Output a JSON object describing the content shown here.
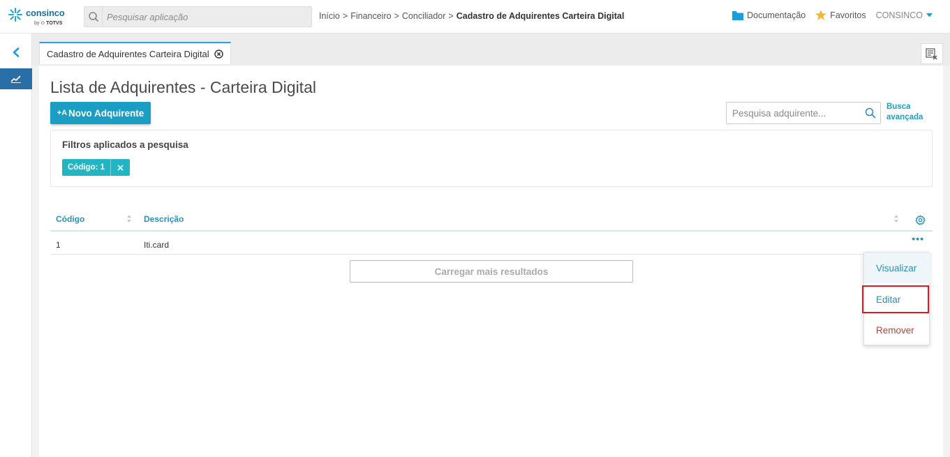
{
  "header": {
    "brand": "consinco",
    "brand_by": "by",
    "brand_company": "TOTVS",
    "search_placeholder": "Pesquisar aplicação",
    "breadcrumb": [
      "Início",
      "Financeiro",
      "Conciliador",
      "Cadastro de Adquirentes Carteira Digital"
    ],
    "breadcrumb_separator": ">",
    "documentation": "Documentação",
    "favorites": "Favoritos",
    "user": "CONSINCO"
  },
  "tabs": [
    {
      "label": "Cadastro de Adquirentes Carteira Digital",
      "active": true
    }
  ],
  "page": {
    "title": "Lista de Adquirentes - Carteira Digital",
    "new_button_prefix": "+A",
    "new_button": "Novo Adquirente",
    "search_placeholder": "Pesquisa adquirente...",
    "advanced_search_line1": "Busca",
    "advanced_search_line2": "avançada"
  },
  "filters": {
    "title": "Filtros aplicados a pesquisa",
    "chips": [
      {
        "label": "Código: 1"
      }
    ]
  },
  "table": {
    "columns": [
      "Código",
      "Descrição"
    ],
    "rows": [
      {
        "codigo": "1",
        "descricao": "Iti.card"
      }
    ],
    "row_menu_icon": "ellipsis-icon"
  },
  "load_more": "Carregar mais resultados",
  "row_menu": {
    "items": [
      "Visualizar",
      "Editar",
      "Remover"
    ],
    "highlighted": "Editar"
  },
  "colors": {
    "primary": "#1a9ec3",
    "chip": "#23b5c4",
    "link": "#2a8fbd",
    "danger": "#b3403a",
    "highlight_box": "#e0191f",
    "rail_active": "#2a6ea8"
  }
}
